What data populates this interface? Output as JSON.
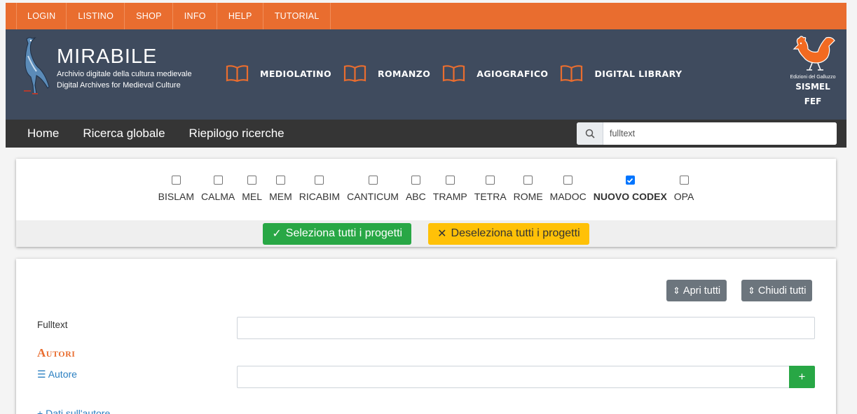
{
  "topbar": [
    "LOGIN",
    "LISTINO",
    "SHOP",
    "INFO",
    "HELP",
    "TUTORIAL"
  ],
  "brand": {
    "name": "MIRABILE",
    "subtitle_it": "Archivio digitale della cultura medievale",
    "subtitle_en": "Digital Archives for Medieval Culture"
  },
  "sections": [
    "MEDIOLATINO",
    "ROMANZO",
    "AGIOGRAFICO",
    "DIGITAL LIBRARY"
  ],
  "publisher": {
    "edition": "Edizioni del Galluzzo",
    "line1": "SISMEL",
    "line2": "FEF"
  },
  "nav": [
    "Home",
    "Ricerca globale",
    "Riepilogo ricerche"
  ],
  "search": {
    "value": "fulltext"
  },
  "projects": [
    {
      "label": "BISLAM",
      "checked": false
    },
    {
      "label": "CALMA",
      "checked": false
    },
    {
      "label": "MEL",
      "checked": false
    },
    {
      "label": "MEM",
      "checked": false
    },
    {
      "label": "RICABIM",
      "checked": false
    },
    {
      "label": "CANTICUM",
      "checked": false
    },
    {
      "label": "ABC",
      "checked": false
    },
    {
      "label": "TRAMP",
      "checked": false
    },
    {
      "label": "TETRA",
      "checked": false
    },
    {
      "label": "ROME",
      "checked": false
    },
    {
      "label": "MADOC",
      "checked": false
    },
    {
      "label": "NUOVO CODEX",
      "checked": true
    },
    {
      "label": "OPA",
      "checked": false
    }
  ],
  "buttons": {
    "select_all": "Seleziona tutti i progetti",
    "deselect_all": "Deseleziona tutti i progetti",
    "open_all": "Apri tutti",
    "close_all": "Chiudi tutti",
    "add": "+"
  },
  "form": {
    "fulltext_label": "Fulltext",
    "autori_heading": "Autori",
    "autore_label": "Autore",
    "dati_autore": "Dati sull'autore"
  },
  "colors": {
    "accent": "#e96d2f",
    "header": "#3f4b5e",
    "nav": "#353535"
  }
}
